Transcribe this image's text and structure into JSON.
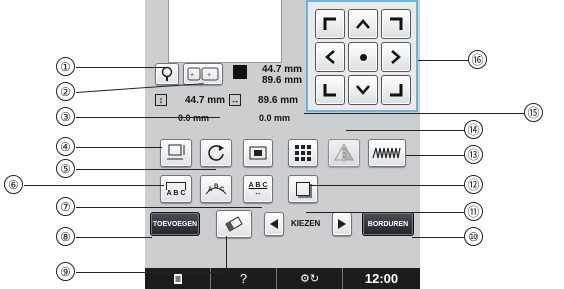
{
  "info": {
    "height_mm": "44.7 mm",
    "width_mm": "89.6 mm",
    "size_h": "44.7 mm",
    "size_w": "89.6 mm",
    "offset_v": "0.0 mm",
    "offset_h": "0.0 mm"
  },
  "buttons": {
    "add": "TOEVOEGEN",
    "embroider": "BORDUREN",
    "select": "KIEZEN",
    "abc1": "A B C",
    "abc2": "A B C",
    "abc3": "A B C"
  },
  "bottom": {
    "help": "?",
    "time": "12:00"
  },
  "callouts": [
    "①",
    "②",
    "③",
    "④",
    "⑤",
    "⑥",
    "⑦",
    "⑧",
    "⑨",
    "⑩",
    "⑪",
    "⑫",
    "⑬",
    "⑭",
    "⑮",
    "⑯"
  ],
  "colors": {
    "screen": "#ccced0",
    "bar": "#1c1c1c",
    "arrowpad_border": "#6bb4e0"
  }
}
